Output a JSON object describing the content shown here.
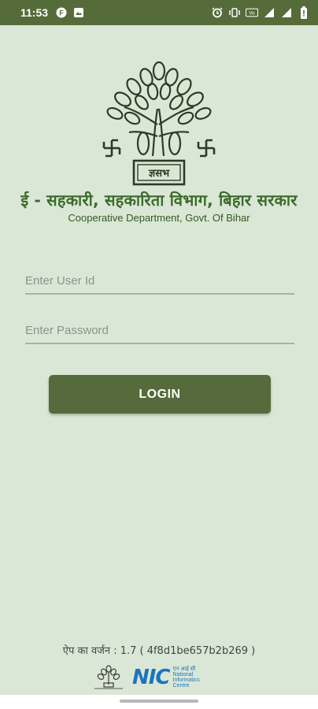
{
  "status_bar": {
    "time": "11:53",
    "icons": [
      "f-icon",
      "image-icon",
      "alarm-icon",
      "vibrate-icon",
      "volte-icon",
      "signal-icon",
      "signal-icon",
      "battery-icon"
    ]
  },
  "logo": {
    "label": "ज्ञसभ"
  },
  "header": {
    "title": "ई - सहकारी, सहकारिता विभाग, बिहार सरकार",
    "subtitle": "Cooperative Department, Govt. Of Bihar"
  },
  "form": {
    "userid_placeholder": "Enter User Id",
    "userid_value": "",
    "password_placeholder": "Enter Password",
    "password_value": "",
    "login_label": "LOGIN"
  },
  "footer": {
    "version": "ऐप का वर्जन : 1.7 ( 4f8d1be657b2b269 )",
    "nic_label": "NIC",
    "nic_hindi": "एन आई सी",
    "nic_line1": "National",
    "nic_line2": "Informatics",
    "nic_line3": "Centre"
  },
  "colors": {
    "background": "#dbe7d6",
    "status_bar": "#556b3a",
    "button": "#566b3c",
    "title": "#3a6b2b"
  }
}
